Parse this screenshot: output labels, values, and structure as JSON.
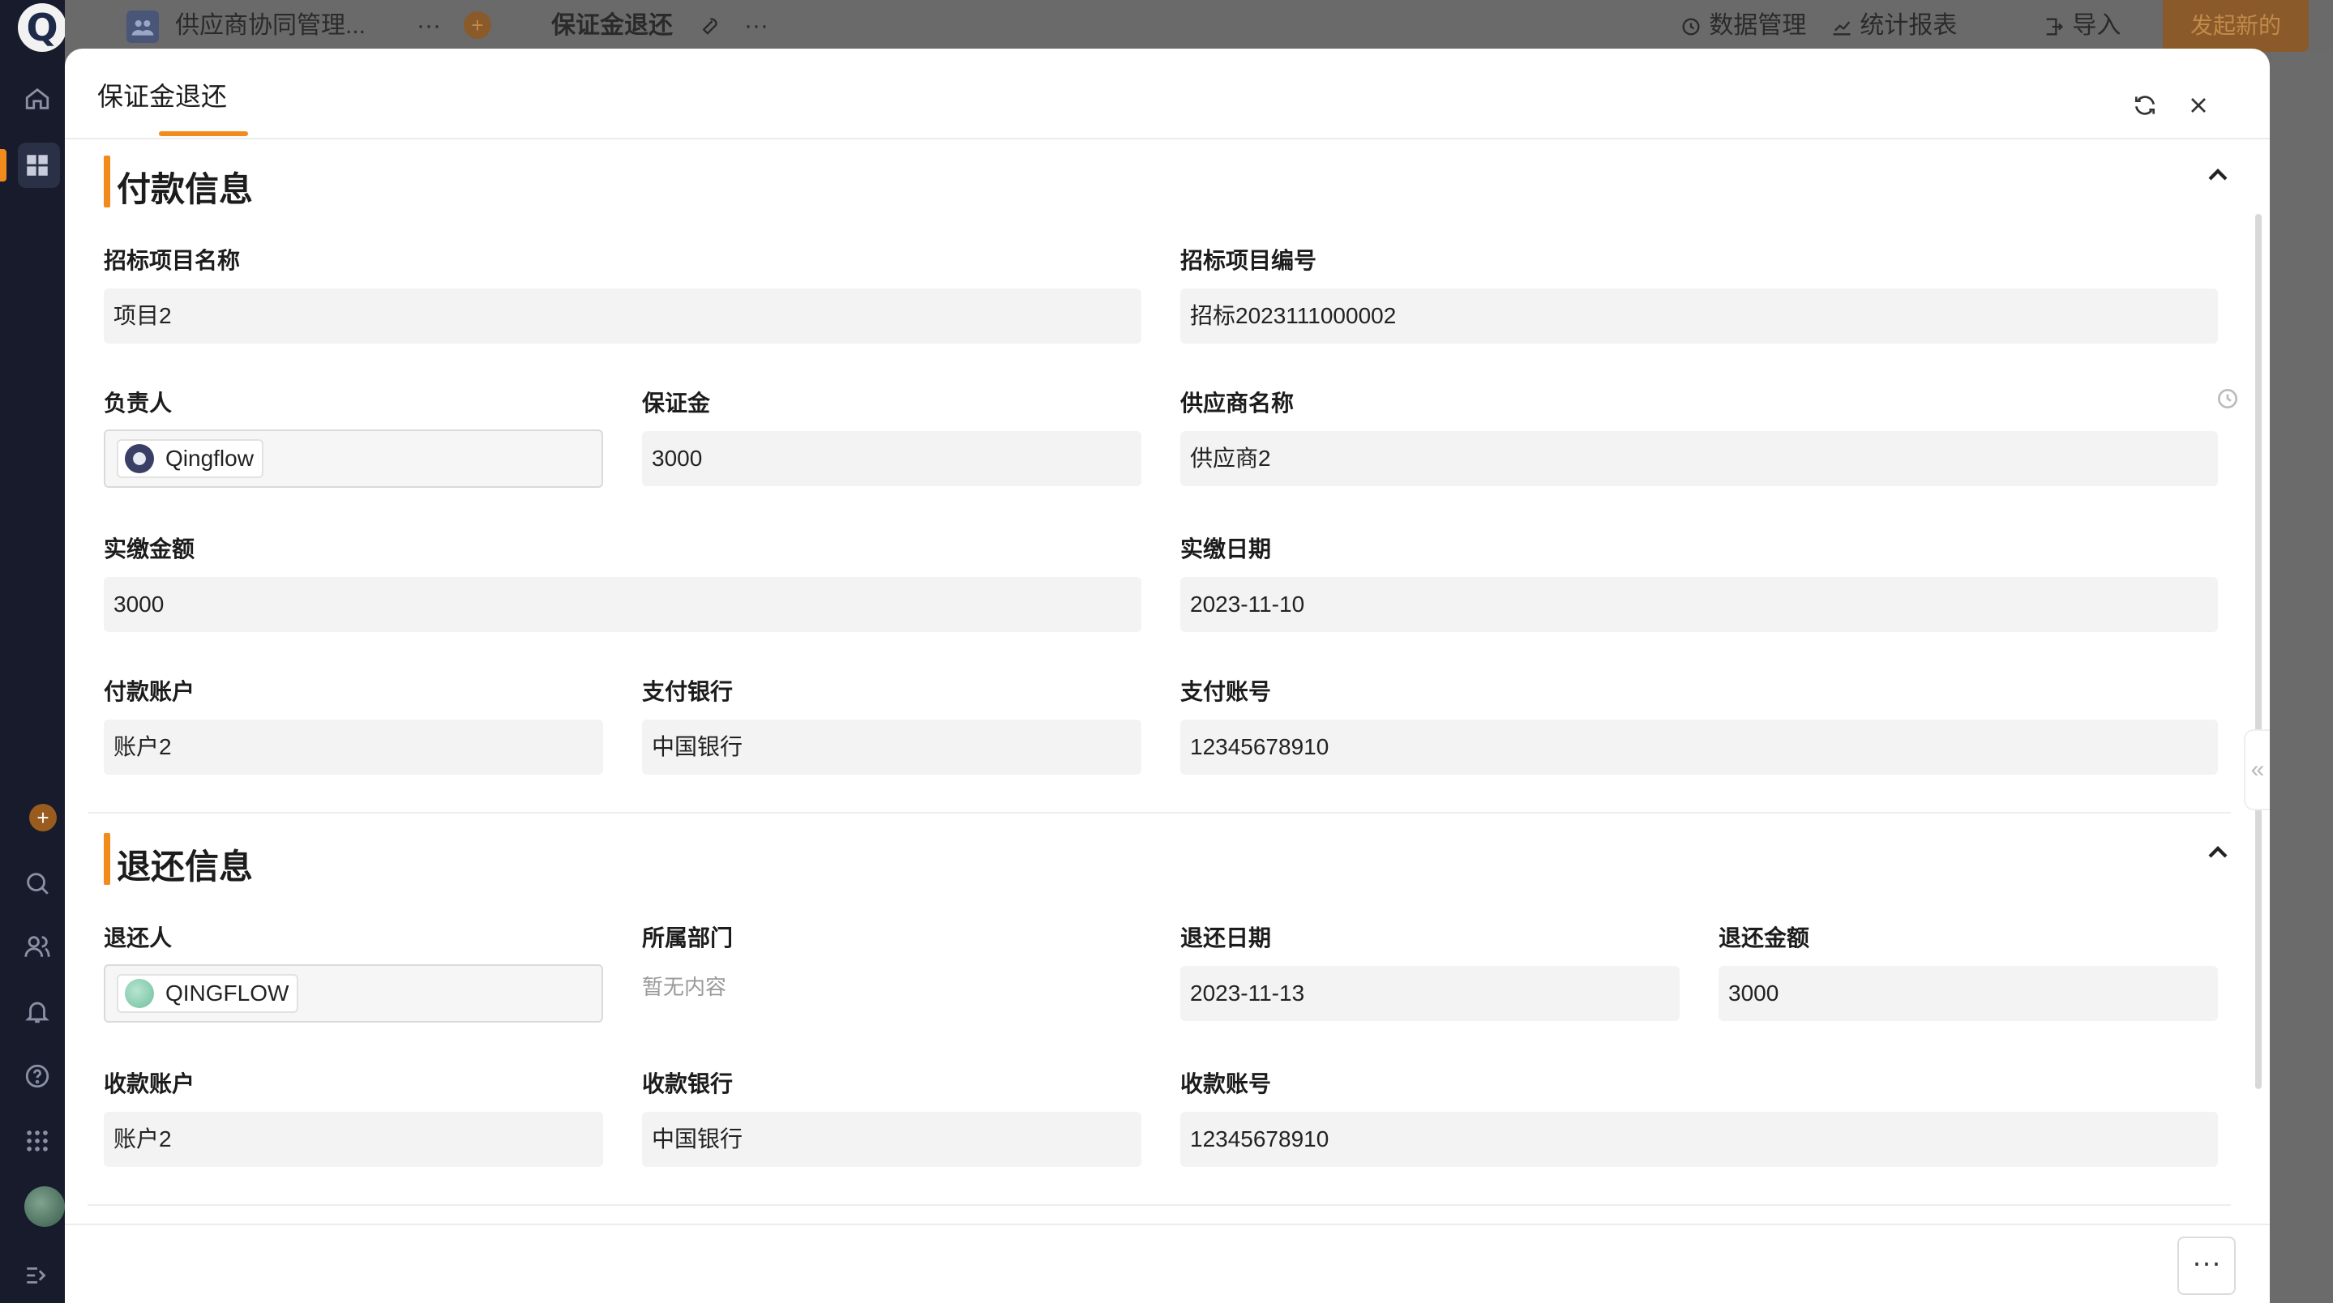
{
  "topbar": {
    "app_name": "供应商协同管理...",
    "form_name": "保证金退还",
    "data_mgmt": "数据管理",
    "stats": "统计报表",
    "import": "导入",
    "new_request": "发起新的",
    "ellipsis": "···"
  },
  "rail": {
    "logo": "Q"
  },
  "modal": {
    "title": "保证金退还",
    "payment_section": {
      "title": "付款信息",
      "fields": {
        "project_name": {
          "label": "招标项目名称",
          "value": "项目2"
        },
        "project_no": {
          "label": "招标项目编号",
          "value": "招标2023111000002"
        },
        "owner": {
          "label": "负责人",
          "value": "Qingflow"
        },
        "deposit": {
          "label": "保证金",
          "value": "3000"
        },
        "supplier": {
          "label": "供应商名称",
          "value": "供应商2"
        },
        "paid_amount": {
          "label": "实缴金额",
          "value": "3000"
        },
        "paid_date": {
          "label": "实缴日期",
          "value": "2023-11-10"
        },
        "pay_account": {
          "label": "付款账户",
          "value": "账户2"
        },
        "pay_bank": {
          "label": "支付银行",
          "value": "中国银行"
        },
        "pay_account_no": {
          "label": "支付账号",
          "value": "12345678910"
        }
      }
    },
    "refund_section": {
      "title": "退还信息",
      "fields": {
        "refunder": {
          "label": "退还人",
          "value": "QINGFLOW"
        },
        "department": {
          "label": "所属部门",
          "value": "暂无内容"
        },
        "refund_date": {
          "label": "退还日期",
          "value": "2023-11-13"
        },
        "refund_amount": {
          "label": "退还金额",
          "value": "3000"
        },
        "recv_account": {
          "label": "收款账户",
          "value": "账户2"
        },
        "recv_bank": {
          "label": "收款银行",
          "value": "中国银行"
        },
        "recv_account_no": {
          "label": "收款账号",
          "value": "12345678910"
        }
      }
    },
    "footer": {
      "more": "···"
    }
  },
  "colors": {
    "accent": "#f28a1c",
    "rail": "#171b2b",
    "field_bg": "#f3f3f3"
  }
}
